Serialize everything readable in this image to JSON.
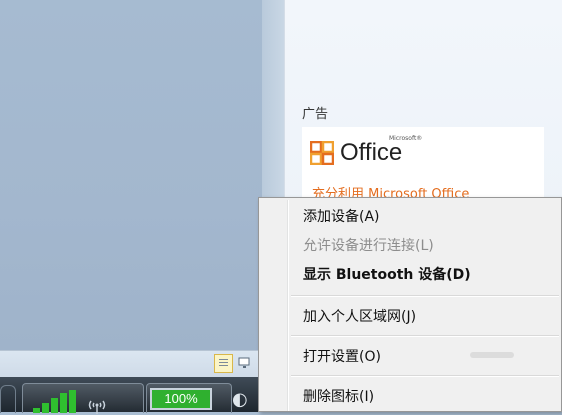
{
  "ad_panel": {
    "heading": "广告",
    "office_name": "Office",
    "office_small": "Microsoft®",
    "tagline": "充分利用 Microsoft Office"
  },
  "context_menu": {
    "items": [
      {
        "label": "添加设备(A)",
        "state": "enabled"
      },
      {
        "label": "允许设备进行连接(L)",
        "state": "disabled"
      },
      {
        "label": "显示 Bluetooth 设备(D)",
        "state": "bold"
      },
      {
        "label": "加入个人区域网(J)",
        "state": "enabled"
      },
      {
        "label": "打开设置(O)",
        "state": "enabled"
      },
      {
        "label": "删除图标(I)",
        "state": "enabled"
      }
    ]
  },
  "taskbar": {
    "battery_label": "100%",
    "icons": [
      "show-hidden-icons",
      "signal-strength-icon",
      "wireless-icon",
      "battery-icon"
    ]
  },
  "colors": {
    "desktop": "#a6bbd1",
    "office_orange": "#e46d1f",
    "battery_green": "#2fb02f",
    "menu_bg": "#f0f0f0"
  }
}
